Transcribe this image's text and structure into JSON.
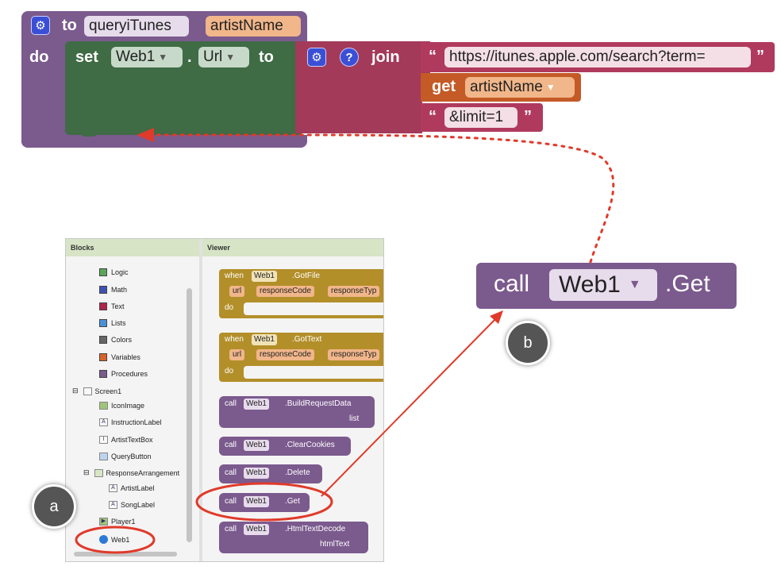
{
  "procedure": {
    "keyword_to": "to",
    "name": "queryiTunes",
    "param": "artistName",
    "keyword_do": "do"
  },
  "set_block": {
    "keyword_set": "set",
    "component": "Web1",
    "dot": ".",
    "property": "Url",
    "keyword_to": "to"
  },
  "join_block": {
    "help": "?",
    "label": "join"
  },
  "strings": {
    "open_quote": "“",
    "close_quote": "”",
    "url_text": "https://itunes.apple.com/search?term=",
    "limit_text": "&limit=1"
  },
  "get_block": {
    "keyword_get": "get",
    "var": "artistName"
  },
  "call_block": {
    "keyword_call": "call",
    "component": "Web1",
    "method": ".Get"
  },
  "panel": {
    "blocks_header": "Blocks",
    "viewer_header": "Viewer",
    "tree": [
      {
        "label": "Logic",
        "color": "#5ba55b"
      },
      {
        "label": "Math",
        "color": "#3f51b5"
      },
      {
        "label": "Text",
        "color": "#b0254a"
      },
      {
        "label": "Lists",
        "color": "#4a90d9"
      },
      {
        "label": "Colors",
        "color": "#666666"
      },
      {
        "label": "Variables",
        "color": "#d9632b"
      },
      {
        "label": "Procedures",
        "color": "#7b5a8e"
      }
    ],
    "screen": "Screen1",
    "components": [
      "IconImage",
      "InstructionLabel",
      "ArtistTextBox",
      "QueryButton"
    ],
    "arrangement": "ResponseArrangement",
    "sub_components": [
      "ArtistLabel",
      "SongLabel"
    ],
    "player": "Player1",
    "web": "Web1",
    "events": [
      {
        "when": "when",
        "component": "Web1",
        "event": ".GotFile",
        "params": [
          "url",
          "responseCode",
          "responseTyp"
        ],
        "do": "do"
      },
      {
        "when": "when",
        "component": "Web1",
        "event": ".GotText",
        "params": [
          "url",
          "responseCode",
          "responseTyp"
        ],
        "do": "do"
      }
    ],
    "calls": [
      {
        "call": "call",
        "component": "Web1",
        "method": ".BuildRequestData",
        "arg": "list"
      },
      {
        "call": "call",
        "component": "Web1",
        "method": ".ClearCookies"
      },
      {
        "call": "call",
        "component": "Web1",
        "method": ".Delete"
      },
      {
        "call": "call",
        "component": "Web1",
        "method": ".Get"
      },
      {
        "call": "call",
        "component": "Web1",
        "method": ".HtmlTextDecode",
        "arg": "htmlText"
      }
    ]
  },
  "badges": {
    "a": "a",
    "b": "b"
  },
  "colors": {
    "procedure": "#7b5a8e",
    "set": "#3f6b45",
    "join": "#a33a5a",
    "get": "#c45a26",
    "arrow": "#e03a2a"
  }
}
